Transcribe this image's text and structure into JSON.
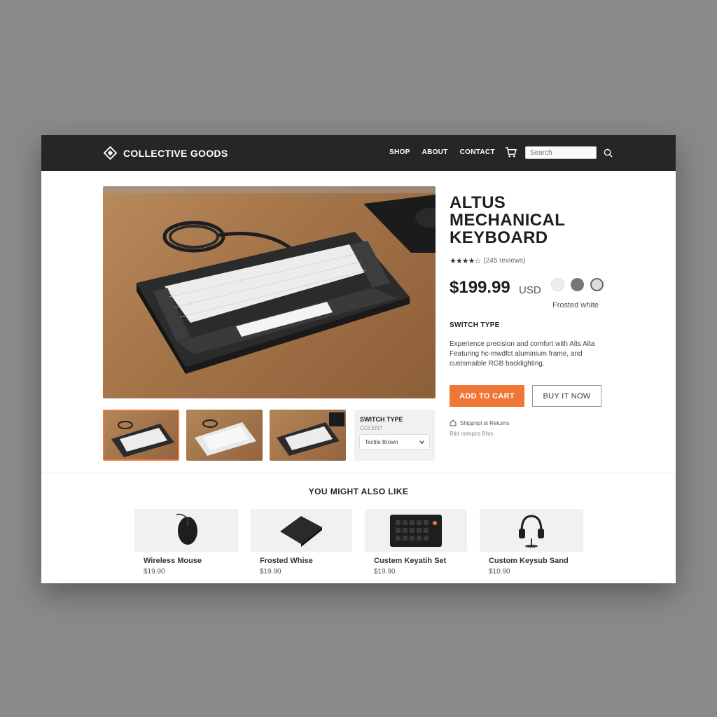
{
  "header": {
    "brand_name": "COLLECTIVE GOODS",
    "nav_links": [
      "SHOP",
      "ABOUT",
      "CONTACT"
    ],
    "search_placeholder": "Search"
  },
  "product": {
    "title_line1": "ALTUS",
    "title_line2": "MECHANICAL",
    "title_line3": "KEYBOARD",
    "stars": "★★★★☆",
    "rating": 4,
    "reviews": "(245 reviews)",
    "price": "$199.99",
    "currency": "USD",
    "swatches": [
      {
        "name": "Frosted white",
        "color": "#eeeeee"
      },
      {
        "name": "Gray",
        "color": "#777777"
      },
      {
        "name": "Light gray",
        "color": "#dcdcdc"
      }
    ],
    "swatch_label": "Frosted white",
    "section_heading": "SWITCH TYPE",
    "description": "Experience precision and comfort with Alts Alta Featuring hc-mwdfct aluminium frame, and custsmaible RGB backlighting.",
    "add_to_cart_label": "ADD TO CART",
    "buy_now_label": "BUY IT NOW",
    "shipping_text": "Shippnpl ot Returns",
    "shipping_sub": "Btid notopcs Bhts"
  },
  "switch_card": {
    "title": "SWITCH TYPE",
    "subtitle": "COLENT",
    "selected": "Tectile Brown"
  },
  "recommendations": {
    "heading": "YOU MIGHT ALSO LIKE",
    "items": [
      {
        "name": "Wireless Mouse",
        "price": "$19.90",
        "icon": "mouse-icon"
      },
      {
        "name": "Frosted Whise",
        "price": "$19.90",
        "icon": "mousepad-icon"
      },
      {
        "name": "Custem Keyatih Set",
        "price": "$19.90",
        "icon": "macropad-icon"
      },
      {
        "name": "Custom Keysub Sand",
        "price": "$10.90",
        "icon": "headphones-icon"
      }
    ]
  },
  "colors": {
    "accent": "#ef7637",
    "navbar": "#262626"
  }
}
